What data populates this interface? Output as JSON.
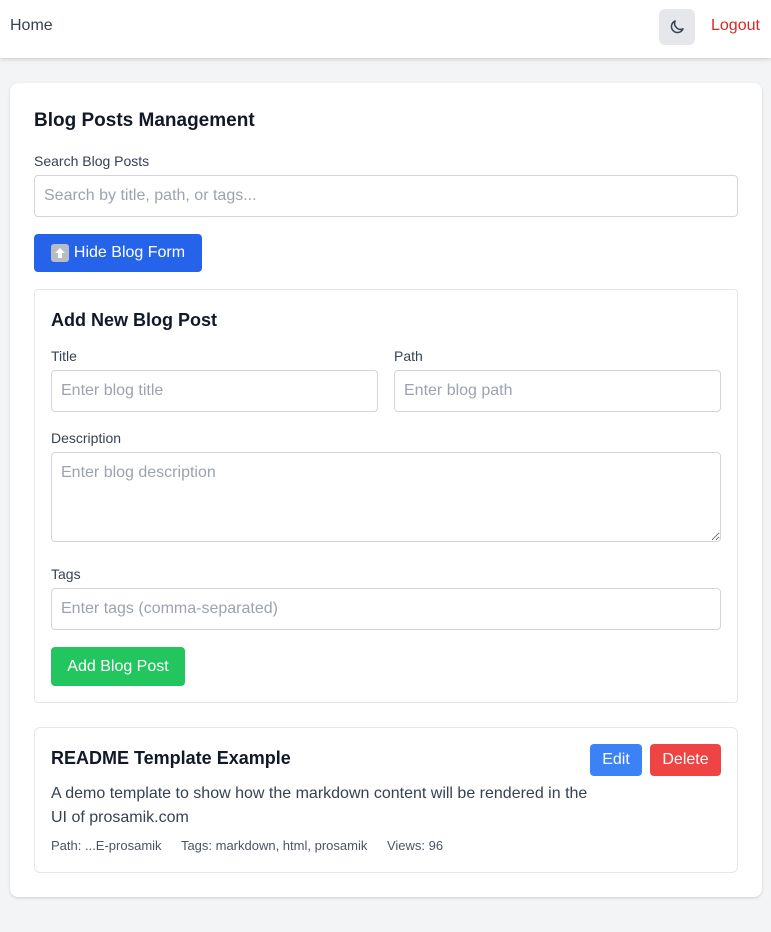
{
  "nav": {
    "home_label": "Home",
    "theme_toggle_icon": "moon-icon",
    "logout_label": "Logout"
  },
  "page": {
    "title": "Blog Posts Management",
    "search_label": "Search Blog Posts",
    "search_placeholder": "Search by title, path, or tags...",
    "search_value": "",
    "toggle_form_icon": "up-arrow-icon",
    "toggle_form_label": "Hide Blog Form"
  },
  "form": {
    "title": "Add New Blog Post",
    "title_label": "Title",
    "title_placeholder": "Enter blog title",
    "path_label": "Path",
    "path_placeholder": "Enter blog path",
    "description_label": "Description",
    "description_placeholder": "Enter blog description",
    "tags_label": "Tags",
    "tags_placeholder": "Enter tags (comma-separated)",
    "submit_label": "Add Blog Post"
  },
  "posts": [
    {
      "title": "README Template Example",
      "description": "A demo template to show how the markdown content will be rendered in the UI of prosamik.com",
      "path": "Path: ...E-prosamik",
      "tags": "Tags: markdown, html, prosamik",
      "views": "Views: 96",
      "edit_label": "Edit",
      "delete_label": "Delete"
    }
  ],
  "colors": {
    "primary": "#2563eb",
    "success": "#22c55e",
    "edit": "#3b82f6",
    "danger": "#ef4444",
    "logout": "#dc2626"
  }
}
